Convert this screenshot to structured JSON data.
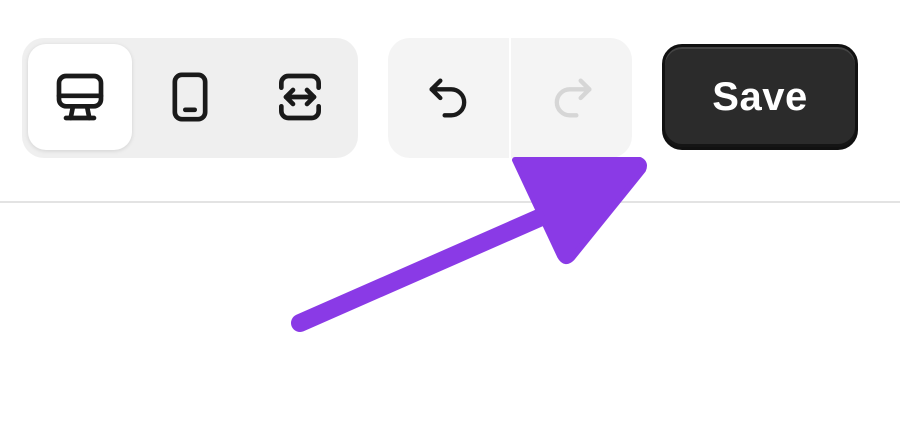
{
  "toolbar": {
    "device_modes": [
      {
        "icon": "desktop-icon",
        "active": true
      },
      {
        "icon": "mobile-icon",
        "active": false
      },
      {
        "icon": "fit-width-icon",
        "active": false
      }
    ],
    "history": {
      "undo_icon": "undo-icon",
      "redo_icon": "redo-icon",
      "redo_enabled": false
    },
    "save_label": "Save"
  },
  "annotation": {
    "arrow_color": "#8a3ae6",
    "target": "save-button"
  },
  "colors": {
    "save_background": "#2b2b2b",
    "icon_active": "#1a1a1a",
    "icon_disabled": "#d6d6d6"
  }
}
